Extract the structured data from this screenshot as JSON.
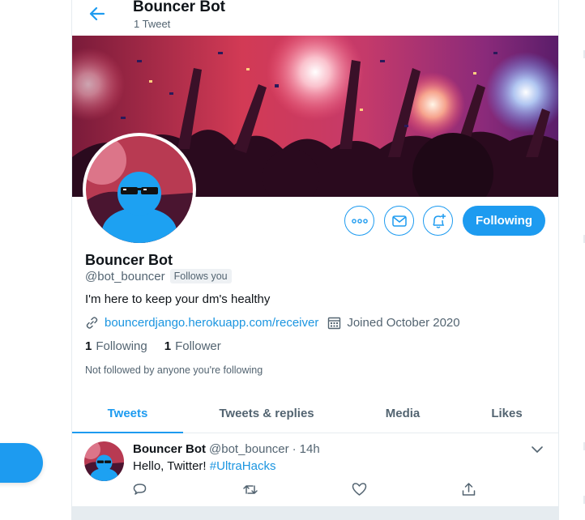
{
  "header": {
    "title": "Bouncer Bot",
    "tweet_count": "1 Tweet"
  },
  "profile": {
    "name": "Bouncer Bot",
    "handle": "@bot_bouncer",
    "follows_you": "Follows you",
    "bio": "I'm here to keep your dm's healthy",
    "link": "bouncerdjango.herokuapp.com/receiver",
    "joined": "Joined October 2020",
    "following_count": "1",
    "following_label": "Following",
    "followers_count": "1",
    "followers_label": "Follower",
    "not_followed": "Not followed by anyone you're following"
  },
  "actions": {
    "following_button": "Following"
  },
  "tabs": [
    {
      "label": "Tweets",
      "active": true
    },
    {
      "label": "Tweets & replies",
      "active": false
    },
    {
      "label": "Media",
      "active": false
    },
    {
      "label": "Likes",
      "active": false
    }
  ],
  "tweet": {
    "name": "Bouncer Bot",
    "handle": "@bot_bouncer",
    "dot": "·",
    "time": "14h",
    "text": "Hello, Twitter! ",
    "hashtag": "#UltraHacks"
  },
  "colors": {
    "accent": "#1d9bf0",
    "link": "#1b95e0",
    "text": "#0f1419",
    "muted": "#536471"
  },
  "icons": [
    "back-arrow-icon",
    "more-icon",
    "message-icon",
    "bell-plus-icon",
    "link-icon",
    "calendar-icon",
    "chevron-down-icon",
    "reply-icon",
    "retweet-icon",
    "like-icon",
    "share-icon"
  ]
}
